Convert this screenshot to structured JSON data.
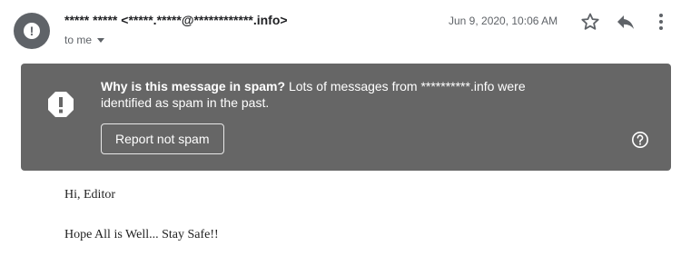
{
  "header": {
    "sender_name": "***** *****",
    "sender_email": "<*****.*****@************.info>",
    "recipient": "to me",
    "date": "Jun 9, 2020, 10:06 AM",
    "avatar_icon": "warning-icon",
    "actions": [
      {
        "name": "star",
        "icon": "star-outline-icon"
      },
      {
        "name": "reply",
        "icon": "reply-icon"
      },
      {
        "name": "more",
        "icon": "more-vert-icon"
      }
    ]
  },
  "spam_banner": {
    "question": "Why is this message in spam?",
    "explanation": "Lots of messages from **********.info were identified as spam in the past.",
    "button_label": "Report not spam",
    "icon": "warning-icon",
    "help_icon": "help-circle-icon",
    "background_color": "#666666"
  },
  "message_body": {
    "greeting": "Hi, Editor",
    "line": "Hope All is Well... Stay Safe!!"
  }
}
